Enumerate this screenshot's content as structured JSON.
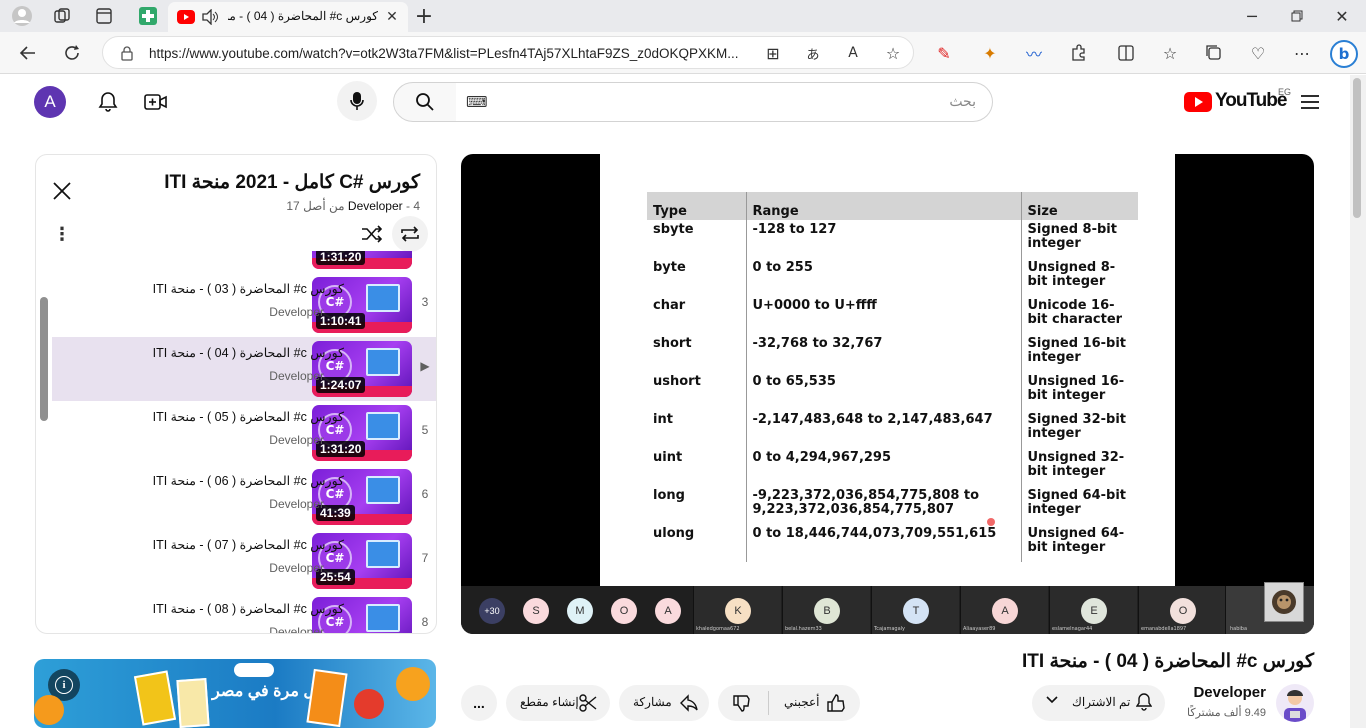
{
  "browser": {
    "tab_title": "كورس c# المحاضرة ( 04 ) - منـ",
    "url": "https://www.youtube.com/watch?v=otk2W3ta7FM&list=PLesfn4TAj57XLhtaF9ZS_z0dOKQPXKM..."
  },
  "youtube": {
    "logo_text": "YouTube",
    "region": "EG",
    "search_placeholder": "بحث",
    "avatar_letter": "A"
  },
  "playlist": {
    "title": "كورس #C كامل - 2021 منحة ITI",
    "channel": "Developer",
    "position": "4 من أصل 17",
    "partial_top_duration": "1:31:20",
    "items": [
      {
        "index": "3",
        "title": "كورس c# المحاضرة ( 03 ) - منحة ITI",
        "channel": "Developer",
        "duration": "1:10:41",
        "active": false
      },
      {
        "index": "▶",
        "title": "كورس c# المحاضرة ( 04 ) - منحة ITI",
        "channel": "Developer",
        "duration": "1:24:07",
        "active": true
      },
      {
        "index": "5",
        "title": "كورس c# المحاضرة ( 05 ) - منحة ITI",
        "channel": "Developer",
        "duration": "1:31:20",
        "active": false
      },
      {
        "index": "6",
        "title": "كورس c# المحاضرة ( 06 ) - منحة ITI",
        "channel": "Developer",
        "duration": "41:39",
        "active": false
      },
      {
        "index": "7",
        "title": "كورس c# المحاضرة ( 07 ) - منحة ITI",
        "channel": "Developer",
        "duration": "25:54",
        "active": false
      },
      {
        "index": "8",
        "title": "كورس c# المحاضرة ( 08 ) - منحة ITI",
        "channel": "Developer",
        "duration": "",
        "active": false
      }
    ]
  },
  "slide_table": {
    "headers": [
      "Type",
      "Range",
      "Size"
    ],
    "rows": [
      [
        "sbyte",
        "-128 to 127",
        "Signed 8-bit integer"
      ],
      [
        "byte",
        "0 to 255",
        "Unsigned 8-bit integer"
      ],
      [
        "char",
        "U+0000 to U+ffff",
        "Unicode 16-bit character"
      ],
      [
        "short",
        "-32,768 to 32,767",
        "Signed 16-bit integer"
      ],
      [
        "ushort",
        "0 to 65,535",
        "Unsigned 16-bit integer"
      ],
      [
        "int",
        "-2,147,483,648 to 2,147,483,647",
        "Signed 32-bit integer"
      ],
      [
        "uint",
        "0 to 4,294,967,295",
        "Unsigned 32-bit integer"
      ],
      [
        "long",
        "-9,223,372,036,854,775,808 to 9,223,372,036,854,775,807",
        "Signed 64-bit integer"
      ],
      [
        "ulong",
        "0 to 18,446,744,073,709,551,615",
        "Unsigned 64-bit integer"
      ]
    ]
  },
  "participants": {
    "more": "+30",
    "bubbles": [
      "S",
      "M",
      "O",
      "A"
    ],
    "tiles": [
      {
        "letter": "K",
        "name": "khaledgomaa672",
        "color": "#f7e0c4"
      },
      {
        "letter": "B",
        "name": "belal.hazem33",
        "color": "#dfe6d5"
      },
      {
        "letter": "T",
        "name": "Tcajamagaly",
        "color": "#d4e3f5"
      },
      {
        "letter": "A",
        "name": "Aliaayaser89",
        "color": "#f7d6d6"
      },
      {
        "letter": "E",
        "name": "eslamelnagar44",
        "color": "#e0e6dc"
      },
      {
        "letter": "O",
        "name": "emanabdella1897",
        "color": "#f2e0dc"
      }
    ],
    "last_name": "habiba"
  },
  "video": {
    "title": "كورس c# المحاضرة ( 04 ) - منحة ITI",
    "channel": "Developer",
    "subscribers": "9.49 ألف مشتركًا",
    "subscribed_label": "تم الاشتراك",
    "like_label": "أعجبني",
    "share_label": "مشاركة",
    "clip_label": "إنشاء مقطع",
    "more_label": "..."
  },
  "ad": {
    "text": "لأول مرة في مصر"
  }
}
